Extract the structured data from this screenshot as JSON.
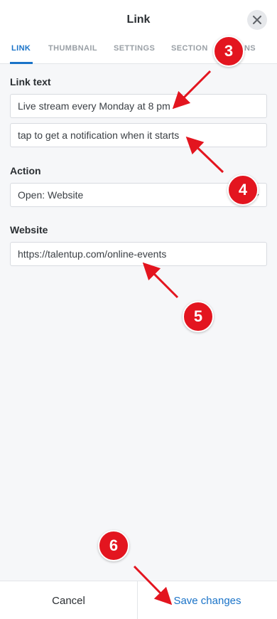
{
  "header": {
    "title": "Link",
    "close_icon": "close-icon"
  },
  "tabs": [
    {
      "label": "LINK",
      "active": true
    },
    {
      "label": "THUMBNAIL",
      "active": false
    },
    {
      "label": "SETTINGS",
      "active": false
    },
    {
      "label": "SECTION",
      "active": false
    },
    {
      "label": "ONS",
      "active": false
    }
  ],
  "link_text": {
    "label": "Link text",
    "line1": "Live stream every Monday at 8 pm",
    "line2": "tap to get a notification when it starts"
  },
  "action": {
    "label": "Action",
    "value": "Open: Website"
  },
  "website": {
    "label": "Website",
    "value": "https://talentup.com/online-events"
  },
  "footer": {
    "cancel_label": "Cancel",
    "save_label": "Save changes"
  },
  "annotations": {
    "color": "#e3151f",
    "steps": [
      "3",
      "4",
      "5",
      "6"
    ]
  },
  "colors": {
    "accent": "#1a73c8",
    "annotation": "#e3151f"
  }
}
